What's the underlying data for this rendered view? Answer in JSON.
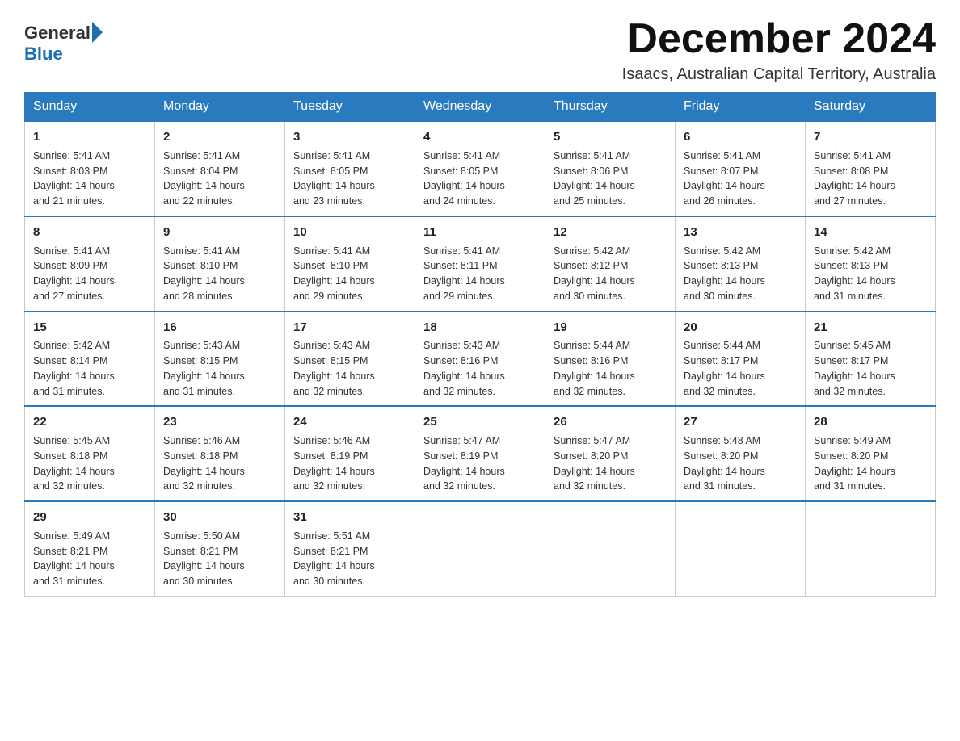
{
  "header": {
    "logo_general": "General",
    "logo_blue": "Blue",
    "month_year": "December 2024",
    "location": "Isaacs, Australian Capital Territory, Australia"
  },
  "days_of_week": [
    "Sunday",
    "Monday",
    "Tuesday",
    "Wednesday",
    "Thursday",
    "Friday",
    "Saturday"
  ],
  "weeks": [
    [
      {
        "day": "1",
        "sunrise": "5:41 AM",
        "sunset": "8:03 PM",
        "daylight": "14 hours and 21 minutes."
      },
      {
        "day": "2",
        "sunrise": "5:41 AM",
        "sunset": "8:04 PM",
        "daylight": "14 hours and 22 minutes."
      },
      {
        "day": "3",
        "sunrise": "5:41 AM",
        "sunset": "8:05 PM",
        "daylight": "14 hours and 23 minutes."
      },
      {
        "day": "4",
        "sunrise": "5:41 AM",
        "sunset": "8:05 PM",
        "daylight": "14 hours and 24 minutes."
      },
      {
        "day": "5",
        "sunrise": "5:41 AM",
        "sunset": "8:06 PM",
        "daylight": "14 hours and 25 minutes."
      },
      {
        "day": "6",
        "sunrise": "5:41 AM",
        "sunset": "8:07 PM",
        "daylight": "14 hours and 26 minutes."
      },
      {
        "day": "7",
        "sunrise": "5:41 AM",
        "sunset": "8:08 PM",
        "daylight": "14 hours and 27 minutes."
      }
    ],
    [
      {
        "day": "8",
        "sunrise": "5:41 AM",
        "sunset": "8:09 PM",
        "daylight": "14 hours and 27 minutes."
      },
      {
        "day": "9",
        "sunrise": "5:41 AM",
        "sunset": "8:10 PM",
        "daylight": "14 hours and 28 minutes."
      },
      {
        "day": "10",
        "sunrise": "5:41 AM",
        "sunset": "8:10 PM",
        "daylight": "14 hours and 29 minutes."
      },
      {
        "day": "11",
        "sunrise": "5:41 AM",
        "sunset": "8:11 PM",
        "daylight": "14 hours and 29 minutes."
      },
      {
        "day": "12",
        "sunrise": "5:42 AM",
        "sunset": "8:12 PM",
        "daylight": "14 hours and 30 minutes."
      },
      {
        "day": "13",
        "sunrise": "5:42 AM",
        "sunset": "8:13 PM",
        "daylight": "14 hours and 30 minutes."
      },
      {
        "day": "14",
        "sunrise": "5:42 AM",
        "sunset": "8:13 PM",
        "daylight": "14 hours and 31 minutes."
      }
    ],
    [
      {
        "day": "15",
        "sunrise": "5:42 AM",
        "sunset": "8:14 PM",
        "daylight": "14 hours and 31 minutes."
      },
      {
        "day": "16",
        "sunrise": "5:43 AM",
        "sunset": "8:15 PM",
        "daylight": "14 hours and 31 minutes."
      },
      {
        "day": "17",
        "sunrise": "5:43 AM",
        "sunset": "8:15 PM",
        "daylight": "14 hours and 32 minutes."
      },
      {
        "day": "18",
        "sunrise": "5:43 AM",
        "sunset": "8:16 PM",
        "daylight": "14 hours and 32 minutes."
      },
      {
        "day": "19",
        "sunrise": "5:44 AM",
        "sunset": "8:16 PM",
        "daylight": "14 hours and 32 minutes."
      },
      {
        "day": "20",
        "sunrise": "5:44 AM",
        "sunset": "8:17 PM",
        "daylight": "14 hours and 32 minutes."
      },
      {
        "day": "21",
        "sunrise": "5:45 AM",
        "sunset": "8:17 PM",
        "daylight": "14 hours and 32 minutes."
      }
    ],
    [
      {
        "day": "22",
        "sunrise": "5:45 AM",
        "sunset": "8:18 PM",
        "daylight": "14 hours and 32 minutes."
      },
      {
        "day": "23",
        "sunrise": "5:46 AM",
        "sunset": "8:18 PM",
        "daylight": "14 hours and 32 minutes."
      },
      {
        "day": "24",
        "sunrise": "5:46 AM",
        "sunset": "8:19 PM",
        "daylight": "14 hours and 32 minutes."
      },
      {
        "day": "25",
        "sunrise": "5:47 AM",
        "sunset": "8:19 PM",
        "daylight": "14 hours and 32 minutes."
      },
      {
        "day": "26",
        "sunrise": "5:47 AM",
        "sunset": "8:20 PM",
        "daylight": "14 hours and 32 minutes."
      },
      {
        "day": "27",
        "sunrise": "5:48 AM",
        "sunset": "8:20 PM",
        "daylight": "14 hours and 31 minutes."
      },
      {
        "day": "28",
        "sunrise": "5:49 AM",
        "sunset": "8:20 PM",
        "daylight": "14 hours and 31 minutes."
      }
    ],
    [
      {
        "day": "29",
        "sunrise": "5:49 AM",
        "sunset": "8:21 PM",
        "daylight": "14 hours and 31 minutes."
      },
      {
        "day": "30",
        "sunrise": "5:50 AM",
        "sunset": "8:21 PM",
        "daylight": "14 hours and 30 minutes."
      },
      {
        "day": "31",
        "sunrise": "5:51 AM",
        "sunset": "8:21 PM",
        "daylight": "14 hours and 30 minutes."
      },
      null,
      null,
      null,
      null
    ]
  ],
  "labels": {
    "sunrise": "Sunrise:",
    "sunset": "Sunset:",
    "daylight": "Daylight:"
  }
}
